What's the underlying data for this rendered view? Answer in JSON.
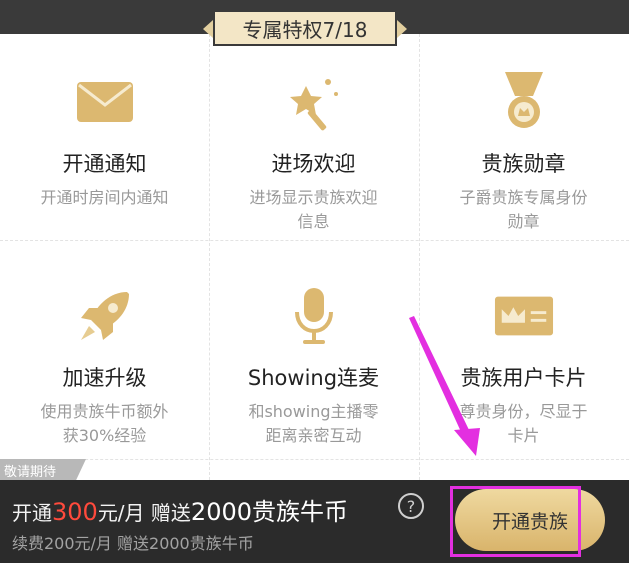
{
  "ribbon": {
    "label": "专属特权7/18"
  },
  "privileges": [
    {
      "title": "开通通知",
      "desc": "开通时房间内通知",
      "icon": "envelope-icon"
    },
    {
      "title": "进场欢迎",
      "desc": "进场显示贵族欢迎信息",
      "icon": "magic-wand-icon"
    },
    {
      "title": "贵族勋章",
      "desc": "子爵贵族专属身份勋章",
      "icon": "medal-icon"
    },
    {
      "title": "加速升级",
      "desc": "使用贵族牛币额外获30%经验",
      "icon": "rocket-icon"
    },
    {
      "title": "Showing连麦",
      "desc": "和showing主播零距离亲密互动",
      "icon": "microphone-icon"
    },
    {
      "title": "贵族用户卡片",
      "desc": "尊贵身份，尽显于卡片",
      "icon": "crown-card-icon"
    }
  ],
  "coming_soon": "敬请期待",
  "purchase": {
    "open_prefix": "开通",
    "open_price": "300",
    "open_unit": "元/月 赠送",
    "open_bonus": "2000贵族牛币",
    "renew": "续费200元/月 赠送2000贵族牛币",
    "help_symbol": "?",
    "button_label": "开通贵族"
  },
  "colors": {
    "gold": "#dcb870",
    "price_red": "#ff4a3c",
    "highlight": "#e32fe0",
    "bar": "#2b2b2b"
  }
}
